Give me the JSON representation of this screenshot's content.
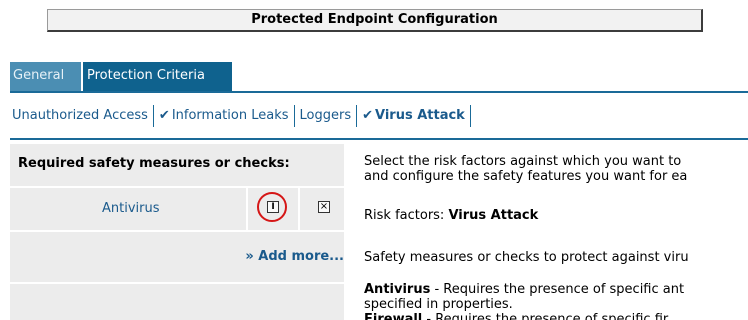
{
  "window_title": "Protected Endpoint Configuration",
  "tabs": [
    {
      "label": "General"
    },
    {
      "label": "Protection Criteria"
    }
  ],
  "subnav": {
    "unauthorized_access": "Unauthorized Access",
    "information_leaks": "Information Leaks",
    "loggers": "Loggers",
    "virus_attack": "Virus Attack",
    "check_mark": "✔"
  },
  "left": {
    "header": "Required safety measures or checks:",
    "measures": [
      {
        "label": "Antivirus",
        "properties_icon": "properties-icon",
        "remove_icon": "remove-icon"
      }
    ],
    "add_more": "» Add more..."
  },
  "right": {
    "intro_line1": "Select the risk factors against which you want to",
    "intro_line2": "and configure the safety features you want for ea",
    "risk_label": "Risk factors: ",
    "risk_value": "Virus Attack",
    "safety_line": "Safety measures or checks to protect against viru",
    "antivirus_term": "Antivirus",
    "antivirus_desc": " - Requires the presence of specific ant",
    "antivirus_line2": "specified in properties.",
    "firewall_term": "Firewall",
    "firewall_desc": " - Requires the presence of specific fir"
  },
  "colors": {
    "accent": "#0f628e",
    "link": "#1a5a8c",
    "highlight_circle": "#d51616"
  }
}
